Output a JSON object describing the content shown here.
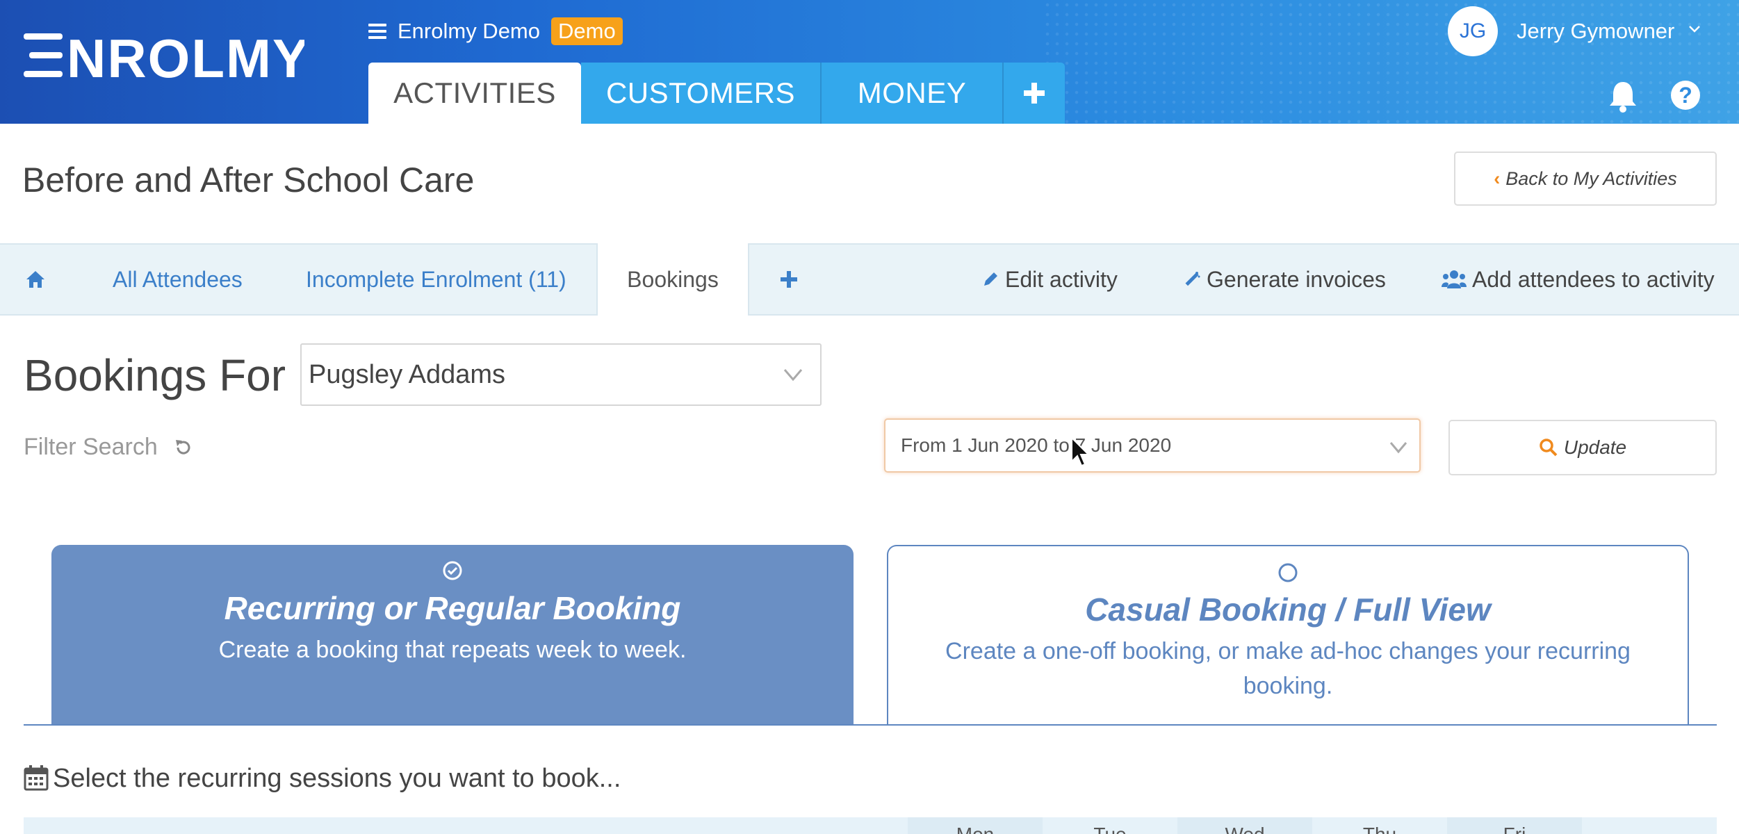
{
  "header": {
    "org_name": "Enrolmy Demo",
    "demo_badge": "Demo",
    "tabs": [
      {
        "label": "ACTIVITIES",
        "active": true
      },
      {
        "label": "CUSTOMERS",
        "active": false
      },
      {
        "label": "MONEY",
        "active": false
      }
    ],
    "user": {
      "initials": "JG",
      "name": "Jerry Gymowner"
    },
    "help_label": "?"
  },
  "page": {
    "title": "Before and After School Care",
    "back_button": "Back to My Activities"
  },
  "subnav": {
    "all_attendees": "All Attendees",
    "incomplete_enrolment": "Incomplete Enrolment (11)",
    "bookings": "Bookings",
    "edit_activity": "Edit activity",
    "generate_invoices": "Generate invoices",
    "add_attendees": "Add attendees to activity"
  },
  "bookings": {
    "heading": "Bookings For",
    "attendee_selected": "Pugsley Addams",
    "filter_search": "Filter Search",
    "date_range": "From 1 Jun 2020 to 7 Jun 2020",
    "update_button": "Update"
  },
  "booking_types": [
    {
      "title": "Recurring or Regular Booking",
      "description": "Create a booking that repeats week to week.",
      "selected": true
    },
    {
      "title": "Casual Booking / Full View",
      "description": "Create a one-off booking, or make ad-hoc changes your recurring booking.",
      "selected": false
    }
  ],
  "sessions": {
    "instruction": "Select the recurring sessions you want to book...",
    "days": [
      "Mon",
      "Tue",
      "Wed",
      "Thu",
      "Fri"
    ]
  },
  "colors": {
    "header_start": "#1c4fb3",
    "header_end": "#3fa2e6",
    "tab_inactive": "#33a8ec",
    "demo_badge": "#f7a11a",
    "link_blue": "#3b7fc9",
    "card_selected": "#6a8fc4",
    "accent_orange": "#f08a1e"
  },
  "icons": [
    "hamburger-icon",
    "plus-icon",
    "chevron-down-icon",
    "bell-icon",
    "chevron-left-icon",
    "home-icon",
    "pencil-icon",
    "magic-wand-icon",
    "users-icon",
    "refresh-icon",
    "search-icon",
    "check-circle-icon",
    "circle-icon",
    "calendar-icon"
  ]
}
